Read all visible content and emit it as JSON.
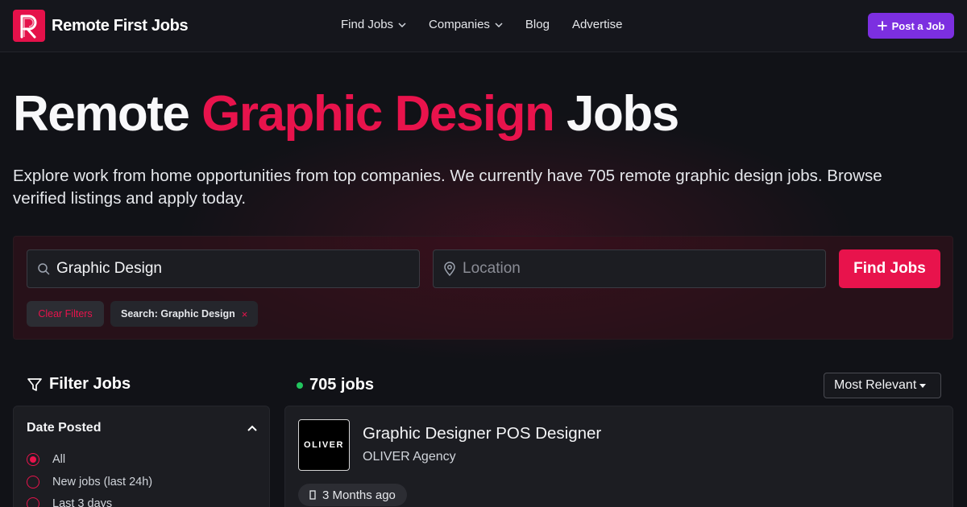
{
  "header": {
    "brand": "Remote First Jobs",
    "nav": [
      {
        "label": "Find Jobs",
        "has_dropdown": true
      },
      {
        "label": "Companies",
        "has_dropdown": true
      },
      {
        "label": "Blog",
        "has_dropdown": false
      },
      {
        "label": "Advertise",
        "has_dropdown": false
      }
    ],
    "post_job_label": "Post a Job"
  },
  "hero": {
    "title_pre": "Remote ",
    "title_accent": "Graphic Design",
    "title_post": " Jobs",
    "description": "Explore work from home opportunities from top companies. We currently have 705 remote graphic design jobs. Browse verified listings and apply today."
  },
  "search": {
    "keyword_value": "Graphic Design",
    "location_placeholder": "Location",
    "find_label": "Find Jobs",
    "clear_filters_label": "Clear Filters",
    "active_filter_label": "Search: Graphic Design",
    "remove_glyph": "×"
  },
  "filters": {
    "title": "Filter Jobs",
    "date_posted": {
      "heading": "Date Posted",
      "options": [
        "All",
        "New jobs (last 24h)",
        "Last 3 days"
      ],
      "selected_index": 0
    }
  },
  "results": {
    "count_label": "705 jobs",
    "sort_label": "Most Relevant",
    "jobs": [
      {
        "title": "Graphic Designer POS Designer",
        "company": "OLIVER Agency",
        "logo_text": "OLIVER",
        "age": "3 Months ago"
      }
    ]
  },
  "colors": {
    "accent": "#e8134c",
    "post_button": "#7c2fe0",
    "status_dot": "#22c55e",
    "background": "#111217"
  }
}
